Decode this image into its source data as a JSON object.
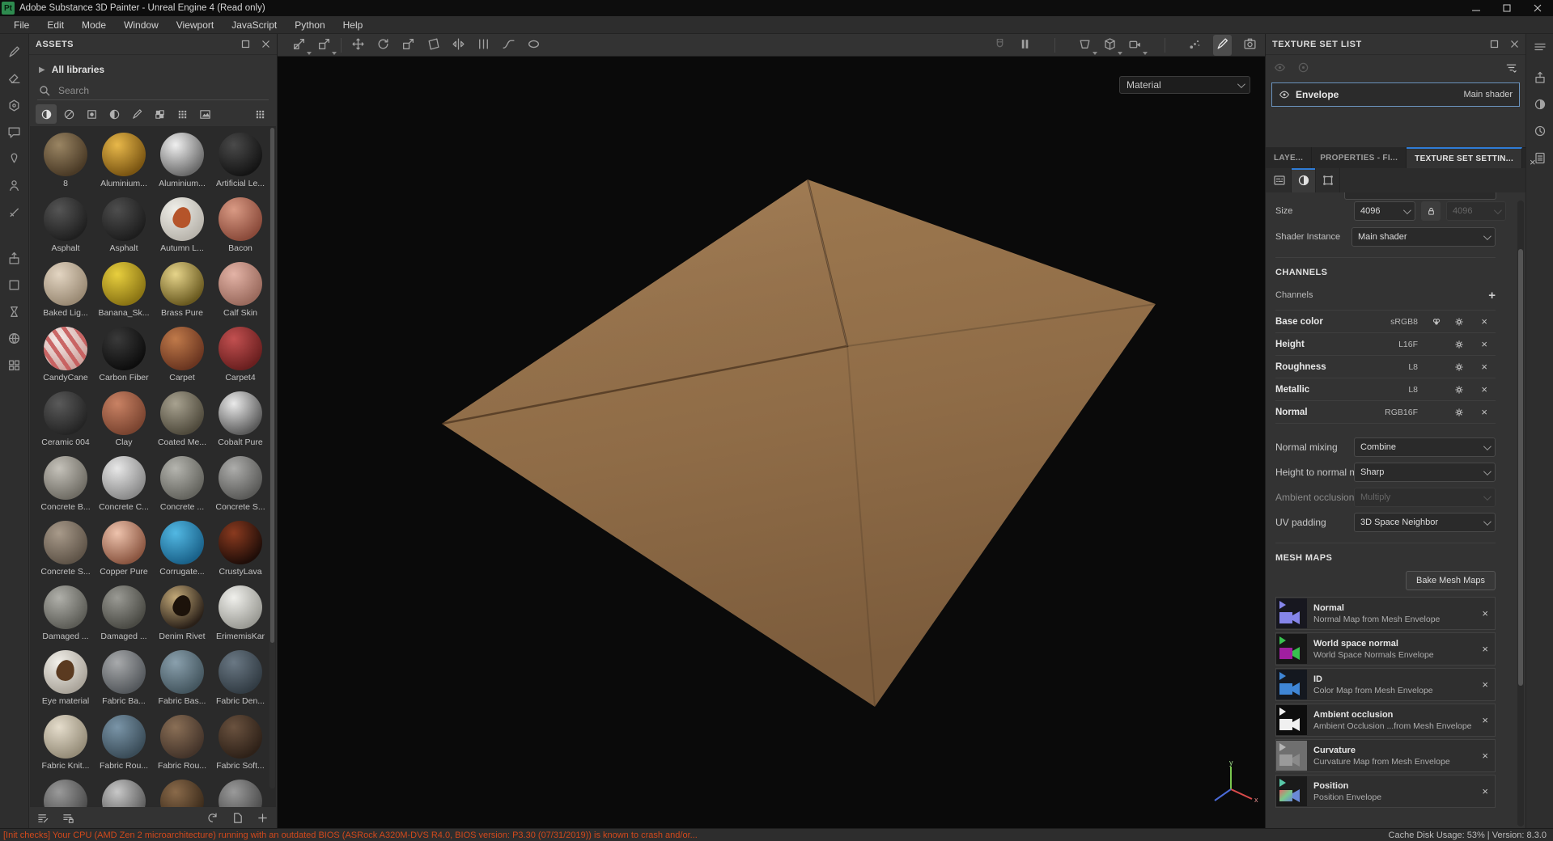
{
  "window": {
    "logo_text": "Pt",
    "title": "Adobe Substance 3D Painter - Unreal Engine 4 (Read only)",
    "menus": [
      "File",
      "Edit",
      "Mode",
      "Window",
      "Viewport",
      "JavaScript",
      "Python",
      "Help"
    ]
  },
  "left_toolbar": [
    {
      "name": "paint-tool",
      "icon": "brush"
    },
    {
      "name": "eraser-tool",
      "icon": "eraser"
    },
    {
      "name": "projection-tool",
      "icon": "hex"
    },
    {
      "name": "polygon-fill-tool",
      "icon": "chat"
    },
    {
      "name": "smudge-tool",
      "icon": "pin"
    },
    {
      "name": "clone-tool",
      "icon": "person"
    },
    {
      "name": "material-picker-tool",
      "icon": "slash"
    },
    {
      "name": "export-textures",
      "icon": "exportbox",
      "group2": true
    },
    {
      "name": "shelf-box",
      "icon": "box"
    },
    {
      "name": "baking-mode",
      "icon": "hourglass"
    },
    {
      "name": "display-settings",
      "icon": "sphere"
    },
    {
      "name": "resources-stack",
      "icon": "stack"
    }
  ],
  "assets": {
    "title": "ASSETS",
    "library_label": "All libraries",
    "search_placeholder": "Search",
    "filters": [
      {
        "name": "materials-filter",
        "icon": "halfsphere",
        "active": true
      },
      {
        "name": "smart-materials-filter",
        "icon": "sphereslash"
      },
      {
        "name": "smart-masks-filter",
        "icon": "maskbox"
      },
      {
        "name": "filters-filter",
        "icon": "halfcircle"
      },
      {
        "name": "brushes-filter",
        "icon": "brush"
      },
      {
        "name": "alphas-filter",
        "icon": "checker"
      },
      {
        "name": "textures-filter",
        "icon": "grid9"
      },
      {
        "name": "environments-filter",
        "icon": "mountain"
      }
    ],
    "grid_view_icon": "grid9",
    "materials": [
      {
        "name": "8",
        "c1": "#9a8563",
        "c2": "#4a3a26"
      },
      {
        "name": "Aluminium...",
        "c1": "#e8b84a",
        "c2": "#7a5512"
      },
      {
        "name": "Aluminium...",
        "c1": "#f0f0f0",
        "c2": "#6a6a6a"
      },
      {
        "name": "Artificial Le...",
        "c1": "#4a4a4a",
        "c2": "#141414"
      },
      {
        "name": "Asphalt",
        "c1": "#555555",
        "c2": "#1f1f1f"
      },
      {
        "name": "Asphalt",
        "c1": "#4e4e4e",
        "c2": "#1d1d1d"
      },
      {
        "name": "Autumn L...",
        "c1": "#f0efe9",
        "c2": "#b8b4ac",
        "accent": "#b5542a"
      },
      {
        "name": "Bacon",
        "c1": "#d99a84",
        "c2": "#8a4a3a"
      },
      {
        "name": "Baked Lig...",
        "c1": "#e3d5c2",
        "c2": "#9a8a74"
      },
      {
        "name": "Banana_Sk...",
        "c1": "#e8cf3e",
        "c2": "#8a7414"
      },
      {
        "name": "Brass Pure",
        "c1": "#e6d48a",
        "c2": "#6a5a20"
      },
      {
        "name": "Calf Skin",
        "c1": "#e3b3a6",
        "c2": "#9a6a5d"
      },
      {
        "name": "CandyCane",
        "c1": "#f5ecea",
        "c2": "#cfa39e",
        "stripes": true
      },
      {
        "name": "Carbon Fiber",
        "c1": "#3a3a3a",
        "c2": "#0d0d0d"
      },
      {
        "name": "Carpet",
        "c1": "#c07a4a",
        "c2": "#6a3520"
      },
      {
        "name": "Carpet4",
        "c1": "#c25050",
        "c2": "#6a1f1f"
      },
      {
        "name": "Ceramic 004",
        "c1": "#5a5a5a",
        "c2": "#242424"
      },
      {
        "name": "Clay",
        "c1": "#c98264",
        "c2": "#7a4430"
      },
      {
        "name": "Coated Me...",
        "c1": "#a8a290",
        "c2": "#4f4a3c"
      },
      {
        "name": "Cobalt Pure",
        "c1": "#eaeaea",
        "c2": "#5a5a5a"
      },
      {
        "name": "Concrete B...",
        "c1": "#c5c2ba",
        "c2": "#6f6c64"
      },
      {
        "name": "Concrete C...",
        "c1": "#e8e8e8",
        "c2": "#8a8a8a"
      },
      {
        "name": "Concrete ...",
        "c1": "#b5b5af",
        "c2": "#64645e"
      },
      {
        "name": "Concrete S...",
        "c1": "#adadab",
        "c2": "#5a5a58"
      },
      {
        "name": "Concrete S...",
        "c1": "#a89a8a",
        "c2": "#5f5448"
      },
      {
        "name": "Copper Pure",
        "c1": "#eec3ad",
        "c2": "#8a5540"
      },
      {
        "name": "Corrugate...",
        "c1": "#52b8e3",
        "c2": "#1a628a"
      },
      {
        "name": "CrustyLava",
        "c1": "#8a3a1f",
        "c2": "#1f0d08"
      },
      {
        "name": "Damaged ...",
        "c1": "#b0b0aa",
        "c2": "#5c5c56"
      },
      {
        "name": "Damaged ...",
        "c1": "#9a9a94",
        "c2": "#4a4a44"
      },
      {
        "name": "Denim Rivet",
        "c1": "#c2a878",
        "c2": "#2a2018",
        "accent": "#1c120a"
      },
      {
        "name": "ErimemisKar",
        "c1": "#f0f0ec",
        "c2": "#9a9a94"
      },
      {
        "name": "Eye material",
        "c1": "#f2f0ea",
        "c2": "#aaa49a",
        "accent": "#5a3a20"
      },
      {
        "name": "Fabric Ba...",
        "c1": "#a8aaac",
        "c2": "#54585c"
      },
      {
        "name": "Fabric Bas...",
        "c1": "#8aa0ad",
        "c2": "#44565f"
      },
      {
        "name": "Fabric Den...",
        "c1": "#6a7884",
        "c2": "#323c44"
      },
      {
        "name": "Fabric Knit...",
        "c1": "#e5ddcc",
        "c2": "#958c78"
      },
      {
        "name": "Fabric Rou...",
        "c1": "#7a95a8",
        "c2": "#3a4c58"
      },
      {
        "name": "Fabric Rou...",
        "c1": "#8a6f56",
        "c2": "#44342a"
      },
      {
        "name": "Fabric Soft...",
        "c1": "#6a523f",
        "c2": "#2e2118"
      },
      {
        "name": "",
        "c1": "#9a9a9a",
        "c2": "#4a4a4a"
      },
      {
        "name": "",
        "c1": "#c8c8c8",
        "c2": "#5a5a5a"
      },
      {
        "name": "",
        "c1": "#8a6a4a",
        "c2": "#3a2a1a"
      },
      {
        "name": "",
        "c1": "#9a9a9a",
        "c2": "#4a4a4a"
      }
    ],
    "footer_icons": [
      {
        "name": "import-resources",
        "icon": "listpencil"
      },
      {
        "name": "resources-updater",
        "icon": "listlock"
      },
      {
        "name": "refresh-shelf",
        "icon": "refresh",
        "right": true
      },
      {
        "name": "new-resource",
        "icon": "doc",
        "right": true
      },
      {
        "name": "add-resource",
        "icon": "plus",
        "right": true
      }
    ]
  },
  "viewport_toolbar": {
    "left": [
      {
        "name": "uv-transform-tool",
        "icon": "moveuv",
        "chev": true
      },
      {
        "name": "uv-manipulate-tool",
        "icon": "scaleuv",
        "chev": true
      }
    ],
    "mid": [
      {
        "name": "move-gizmo",
        "icon": "move"
      },
      {
        "name": "rotate-gizmo",
        "icon": "rotate"
      },
      {
        "name": "scale-gizmo",
        "icon": "scale"
      },
      {
        "name": "quad-transform",
        "icon": "quad"
      },
      {
        "name": "symmetry",
        "icon": "mirror"
      },
      {
        "name": "align",
        "icon": "align"
      },
      {
        "name": "lazy-mouse",
        "icon": "lazy"
      },
      {
        "name": "ellipse-tool",
        "icon": "ellipse"
      }
    ],
    "right1": [
      {
        "name": "snap",
        "icon": "magnet",
        "dim": true
      },
      {
        "name": "pause-engine",
        "icon": "pause"
      }
    ],
    "right2": [
      {
        "name": "viewport-layout",
        "icon": "persp",
        "chev": true
      },
      {
        "name": "camera-3d",
        "icon": "cube",
        "chev": true
      },
      {
        "name": "camera-settings",
        "icon": "camera",
        "chev": true
      }
    ],
    "right3": [
      {
        "name": "particles",
        "icon": "particles"
      },
      {
        "name": "paint-mode",
        "icon": "brush",
        "active": true
      },
      {
        "name": "rendering-mode",
        "icon": "photo"
      }
    ]
  },
  "viewport": {
    "shading_mode": "Material",
    "gizmo_axis_y": "y",
    "gizmo_axis_x": "x",
    "envelope_top": "#a07b51",
    "envelope_bottom": "#7c5c3c",
    "envelope_flap": "#a8835a"
  },
  "texture_set_list": {
    "title": "TEXTURE SET LIST",
    "set_name": "Envelope",
    "shader": "Main shader"
  },
  "tabs": [
    {
      "label": "LAYE...",
      "active": false
    },
    {
      "label": "PROPERTIES - FI...",
      "active": false
    },
    {
      "label": "TEXTURE SET SETTIN...",
      "active": true
    }
  ],
  "tab_close": "×",
  "subtabs": [
    {
      "name": "general-settings-subtab",
      "icon": "sliders",
      "active": false
    },
    {
      "name": "material-subtab",
      "icon": "halfsphere",
      "active": true
    },
    {
      "name": "uv-subtab",
      "icon": "uvframe",
      "active": false
    }
  ],
  "settings": {
    "size_label": "Size",
    "size_value": "4096",
    "size_locked_value": "4096",
    "shader_instance_label": "Shader Instance",
    "shader_instance_value": "Main shader",
    "channels_header": "CHANNELS",
    "channels_label": "Channels",
    "add_channel": "+",
    "channels": [
      {
        "name": "Base color",
        "format": "sRGB8",
        "palette": true
      },
      {
        "name": "Height",
        "format": "L16F"
      },
      {
        "name": "Roughness",
        "format": "L8"
      },
      {
        "name": "Metallic",
        "format": "L8"
      },
      {
        "name": "Normal",
        "format": "RGB16F"
      }
    ],
    "mixing": [
      {
        "label": "Normal mixing",
        "value": "Combine",
        "disabled": false
      },
      {
        "label": "Height to normal method",
        "value": "Sharp",
        "disabled": false
      },
      {
        "label": "Ambient occlusion mixing",
        "value": "Multiply",
        "disabled": true
      },
      {
        "label": "UV padding",
        "value": "3D Space Neighbor",
        "disabled": false
      }
    ],
    "mesh_maps_header": "MESH MAPS",
    "bake_button": "Bake Mesh Maps",
    "mesh_maps": [
      {
        "name": "Normal",
        "desc": "Normal Map from Mesh Envelope",
        "thumb": "normal"
      },
      {
        "name": "World space normal",
        "desc": "World Space Normals Envelope",
        "thumb": "wsn"
      },
      {
        "name": "ID",
        "desc": "Color Map from Mesh Envelope",
        "thumb": "id"
      },
      {
        "name": "Ambient occlusion",
        "desc": "Ambient Occlusion ...from Mesh Envelope",
        "thumb": "ao"
      },
      {
        "name": "Curvature",
        "desc": "Curvature Map from Mesh Envelope",
        "thumb": "curv"
      },
      {
        "name": "Position",
        "desc": "Position Envelope",
        "thumb": "pos"
      }
    ],
    "close_glyph": "×"
  },
  "right_toolbar": [
    {
      "name": "panel-menu",
      "icon": "lines"
    },
    {
      "name": "assets-panel-toggle",
      "icon": "exportbox"
    },
    {
      "name": "display-settings-toggle",
      "icon": "halfsphere"
    },
    {
      "name": "history-panel",
      "icon": "clock"
    },
    {
      "name": "log-panel",
      "icon": "clipboard"
    }
  ],
  "status_bar": {
    "warning": "[Init checks] Your CPU (AMD Zen 2 microarchitecture) running with an outdated BIOS (ASRock A320M-DVS R4.0, BIOS version: P3.30 (07/31/2019)) is known to crash and/or...",
    "right": "Cache Disk Usage:   53% | Version: 8.3.0"
  }
}
